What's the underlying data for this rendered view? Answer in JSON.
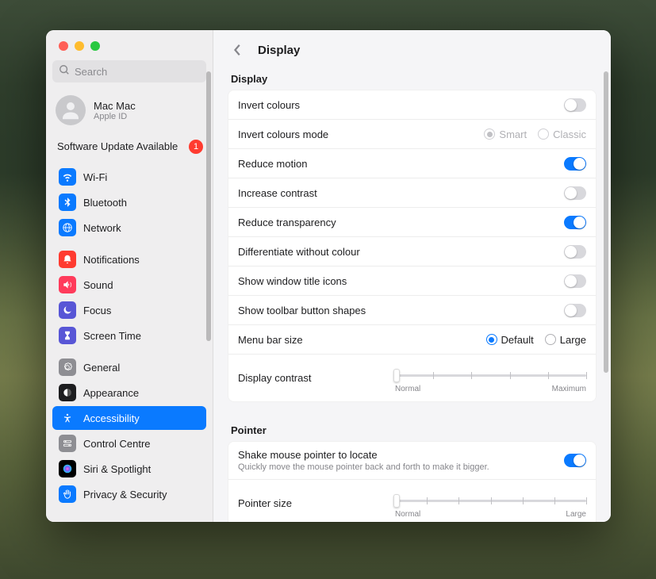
{
  "search": {
    "placeholder": "Search"
  },
  "account": {
    "name": "Mac Mac",
    "sub": "Apple ID"
  },
  "update": {
    "label": "Software Update Available",
    "badge": 1
  },
  "sidebar": {
    "group1": [
      {
        "label": "Wi-Fi",
        "color": "#0a7aff",
        "icon": "wifi"
      },
      {
        "label": "Bluetooth",
        "color": "#0a7aff",
        "icon": "bluetooth"
      },
      {
        "label": "Network",
        "color": "#0a7aff",
        "icon": "globe"
      }
    ],
    "group2": [
      {
        "label": "Notifications",
        "color": "#ff3b30",
        "icon": "bell"
      },
      {
        "label": "Sound",
        "color": "#ff3b5b",
        "icon": "sound"
      },
      {
        "label": "Focus",
        "color": "#5856d6",
        "icon": "moon"
      },
      {
        "label": "Screen Time",
        "color": "#5856d6",
        "icon": "hourglass"
      }
    ],
    "group3": [
      {
        "label": "General",
        "color": "#8e8e93",
        "icon": "gear"
      },
      {
        "label": "Appearance",
        "color": "#1d1d1f",
        "icon": "appearance"
      },
      {
        "label": "Accessibility",
        "color": "#0a7aff",
        "icon": "accessibility",
        "selected": true
      },
      {
        "label": "Control Centre",
        "color": "#8e8e93",
        "icon": "toggles"
      },
      {
        "label": "Siri & Spotlight",
        "color": "#000",
        "icon": "siri"
      },
      {
        "label": "Privacy & Security",
        "color": "#0a7aff",
        "icon": "hand"
      }
    ]
  },
  "page": {
    "title": "Display"
  },
  "display_section": {
    "label": "Display",
    "rows": {
      "invert": "Invert colours",
      "invert_mode": "Invert colours mode",
      "invert_mode_smart": "Smart",
      "invert_mode_classic": "Classic",
      "reduce_motion": "Reduce motion",
      "increase_contrast": "Increase contrast",
      "reduce_transparency": "Reduce transparency",
      "differentiate": "Differentiate without colour",
      "window_icons": "Show window title icons",
      "toolbar_shapes": "Show toolbar button shapes",
      "menubar_size": "Menu bar size",
      "menubar_default": "Default",
      "menubar_large": "Large",
      "display_contrast": "Display contrast",
      "contrast_normal": "Normal",
      "contrast_max": "Maximum"
    },
    "states": {
      "invert": false,
      "reduce_motion": true,
      "increase_contrast": false,
      "reduce_transparency": true,
      "differentiate": false,
      "window_icons": false,
      "toolbar_shapes": false,
      "menubar": "default",
      "invert_mode": "smart",
      "contrast_pos": 0
    }
  },
  "pointer_section": {
    "label": "Pointer",
    "rows": {
      "shake": "Shake mouse pointer to locate",
      "shake_sub": "Quickly move the mouse pointer back and forth to make it bigger.",
      "pointer_size": "Pointer size",
      "size_normal": "Normal",
      "size_large": "Large"
    },
    "states": {
      "shake": true,
      "pointer_pos": 0
    }
  }
}
